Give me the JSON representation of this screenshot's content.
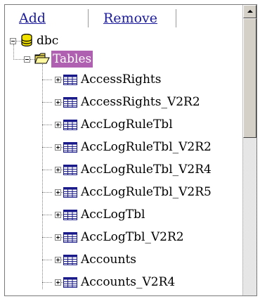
{
  "toolbar": {
    "add_label": "Add",
    "remove_label": "Remove"
  },
  "tree": {
    "root": {
      "label": "dbc",
      "icon": "database-icon",
      "expanded": true
    },
    "folder": {
      "label": "Tables",
      "icon": "folder-open-icon",
      "expanded": true,
      "selected": true
    },
    "tables": [
      {
        "label": "AccessRights"
      },
      {
        "label": "AccessRights_V2R2"
      },
      {
        "label": "AccLogRuleTbl"
      },
      {
        "label": "AccLogRuleTbl_V2R2"
      },
      {
        "label": "AccLogRuleTbl_V2R4"
      },
      {
        "label": "AccLogRuleTbl_V2R5"
      },
      {
        "label": "AccLogTbl"
      },
      {
        "label": "AccLogTbl_V2R2"
      },
      {
        "label": "Accounts"
      },
      {
        "label": "Accounts_V2R4"
      }
    ]
  },
  "colors": {
    "selection": "#b060b0",
    "link": "#1a1a9a"
  }
}
